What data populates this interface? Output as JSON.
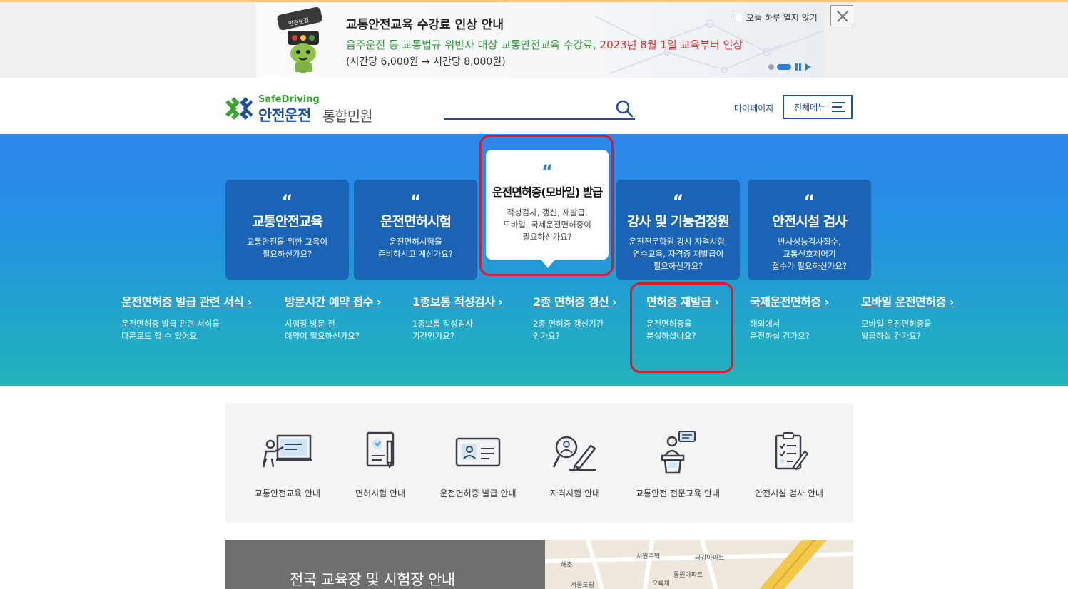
{
  "banner": {
    "mascot_sign": "안전운전",
    "title": "교통안전교육 수강료 인상 안내",
    "line2_normal": "음주운전 등 교통법규 위반자 대상 교통안전교육 수강료, ",
    "line2_red": "2023년 8월 1일 교육부터 인상",
    "line3": "(시간당 6,000원 → 시간당 8,000원)",
    "noshow_label": "오늘 하루 열지 않기"
  },
  "header": {
    "logo_small": "SafeDriving",
    "logo_main": "안전운전",
    "logo_sub": "통합민원",
    "search_placeholder": "",
    "mypage": "마이페이지",
    "menu": "전체메뉴"
  },
  "hero": {
    "quote": "“",
    "cards": [
      {
        "title": "교통안전교육",
        "desc": "교통안전을 위한 교육이\n필요하신가요?"
      },
      {
        "title": "운전면허시험",
        "desc": "운전면허시험을\n준비하시고 계신가요?"
      },
      {
        "title": "운전면허증(모바일) 발급",
        "desc": "적성검사, 갱신, 재발급,\n모바일, 국제운전면허증이\n필요하신가요?"
      },
      {
        "title": "강사 및 기능검정원",
        "desc": "운전전문학원 강사 자격시험,\n연수교육, 자격증 재발급이\n필요하신가요?"
      },
      {
        "title": "안전시설 검사",
        "desc": "반사성능검사접수,\n교통신호제어기\n접수가 필요하신가요?"
      }
    ],
    "links": [
      {
        "title": "운전면허증 발급 관련 서식",
        "desc": "운전면허증 발급 관련 서식을\n다운로드 할 수 있어요"
      },
      {
        "title": "방문시간 예약 접수",
        "desc": "시험장 방문 전\n예약이 필요하신가요?"
      },
      {
        "title": "1종보통 적성검사",
        "desc": "1종보통 적성검사\n기간인가요?"
      },
      {
        "title": "2종 면허증 갱신",
        "desc": "2종 면허증 갱신기간\n인가요?"
      },
      {
        "title": "면허증 재발급",
        "desc": "운전면허증을\n분실하셨나요?"
      },
      {
        "title": "국제운전면허증",
        "desc": "해외에서\n운전하실 건가요?"
      },
      {
        "title": "모바일 운전면허증",
        "desc": "모바일 운전면허증을\n발급하실 건가요?"
      }
    ]
  },
  "quick": [
    {
      "label": "교통안전교육 안내"
    },
    {
      "label": "면허시험 안내"
    },
    {
      "label": "운전면허증 발급 안내"
    },
    {
      "label": "자격시험 안내"
    },
    {
      "label": "교통안전 전문교육 안내"
    },
    {
      "label": "안전시설 검사 안내"
    }
  ],
  "bottom": {
    "title": "전국 교육장 및 시험장 안내",
    "map_labels": [
      "서원주택",
      "금강아파트",
      "동원아파트",
      "오륙채",
      "해조",
      "서울도량"
    ]
  },
  "colors": {
    "brand_blue": "#1e4fa3",
    "card_blue": "#1a63b5",
    "highlight_red": "#e0192a",
    "green": "#2e9a36"
  }
}
